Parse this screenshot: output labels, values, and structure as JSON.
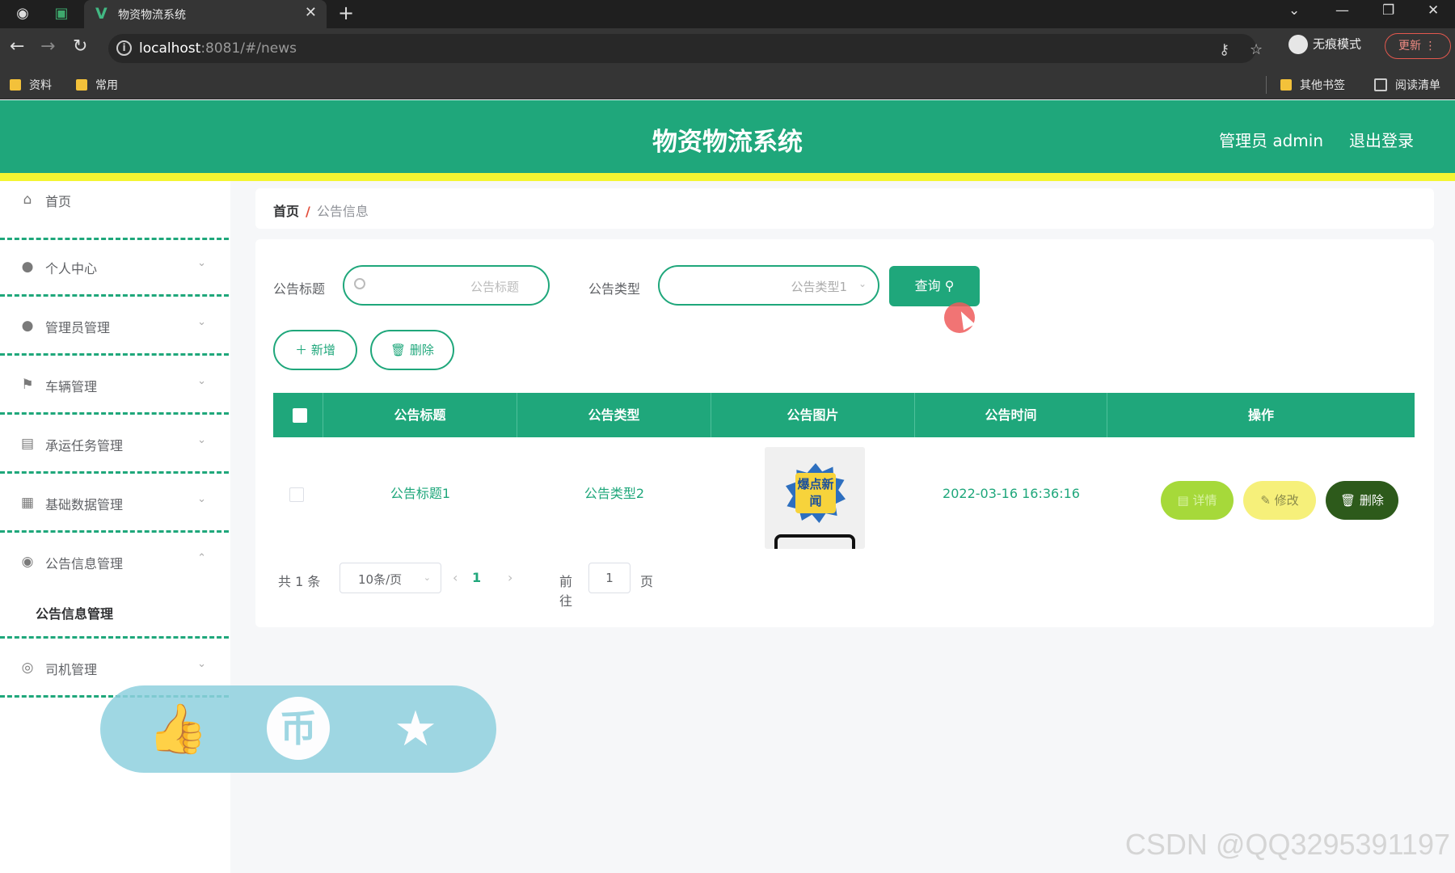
{
  "browser": {
    "tab_title": "物资物流系统",
    "url_host": "localhost",
    "url_rest": ":8081/#/news",
    "incognito_label": "无痕模式",
    "update_label": "更新",
    "bookmarks": [
      "资料",
      "常用"
    ],
    "other_bookmarks": "其他书签",
    "reading_list": "阅读清单"
  },
  "header": {
    "title": "物资物流系统",
    "user": "管理员 admin",
    "logout": "退出登录"
  },
  "sidebar": {
    "items": [
      {
        "label": "首页",
        "icon": "home-icon"
      },
      {
        "label": "个人中心",
        "icon": "user-icon"
      },
      {
        "label": "管理员管理",
        "icon": "user-icon"
      },
      {
        "label": "车辆管理",
        "icon": "flag-icon"
      },
      {
        "label": "承运任务管理",
        "icon": "chat-icon"
      },
      {
        "label": "基础数据管理",
        "icon": "printer-icon"
      },
      {
        "label": "公告信息管理",
        "icon": "location-icon"
      },
      {
        "label": "司机管理",
        "icon": "compass-icon"
      }
    ],
    "submenu": "公告信息管理"
  },
  "breadcrumb": {
    "home": "首页",
    "sep": "/",
    "current": "公告信息"
  },
  "search": {
    "title_label": "公告标题",
    "title_placeholder": "公告标题",
    "type_label": "公告类型",
    "type_value": "公告类型1",
    "query_label": "查询"
  },
  "toolbar": {
    "add_label": "＋ 新增",
    "delete_label": "删除"
  },
  "table": {
    "headers": [
      "公告标题",
      "公告类型",
      "公告图片",
      "公告时间",
      "操作"
    ],
    "rows": [
      {
        "title": "公告标题1",
        "type": "公告类型2",
        "image_text": "爆点新闻",
        "time": "2022-03-16 16:36:16",
        "actions": {
          "detail": "详情",
          "edit": "修改",
          "delete": "删除"
        }
      }
    ]
  },
  "pagination": {
    "total": "共 1 条",
    "page_size": "10条/页",
    "current_page": "1",
    "goto_label": "前往",
    "goto_value": "1",
    "page_unit": "页"
  },
  "colors": {
    "primary": "#1fa77b",
    "accent_strip": "#f4f531",
    "detail_btn": "#a6d93a",
    "edit_btn": "#f6f07a",
    "delete_btn": "#2d5a1b"
  },
  "watermark": "CSDN @QQ3295391197"
}
